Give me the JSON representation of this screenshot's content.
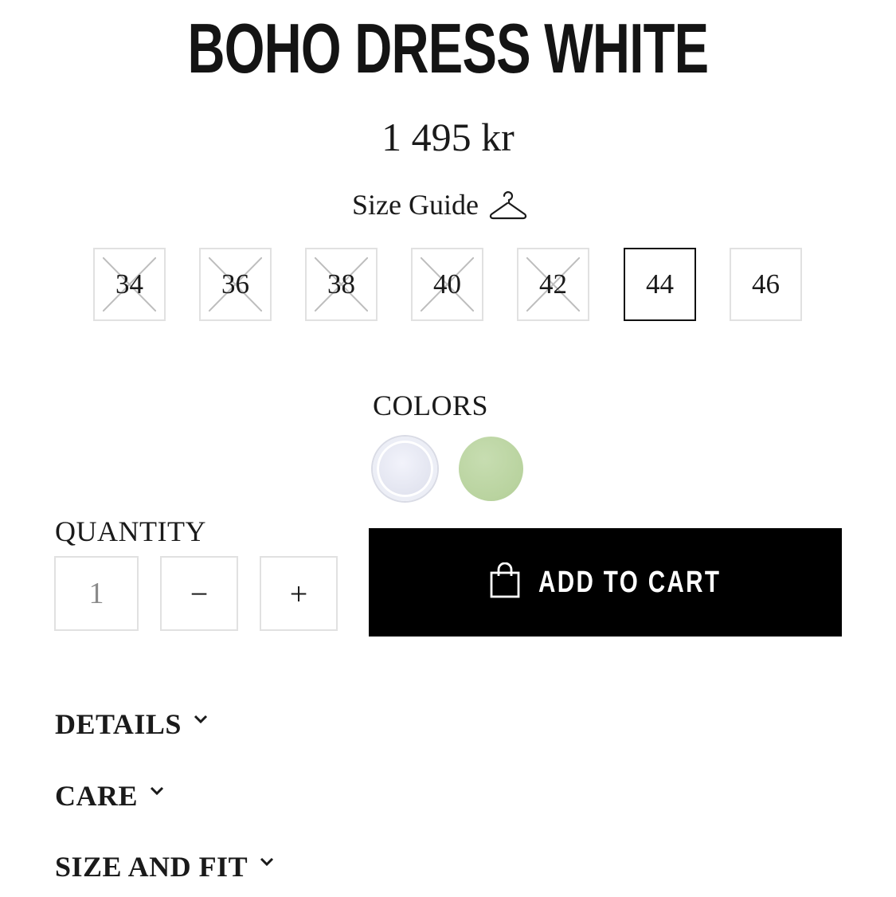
{
  "product": {
    "title": "BOHO DRESS WHITE",
    "price": "1 495 kr"
  },
  "size_guide": {
    "label": "Size Guide",
    "icon": "hanger-icon"
  },
  "sizes": [
    {
      "label": "34",
      "available": false,
      "selected": false
    },
    {
      "label": "36",
      "available": false,
      "selected": false
    },
    {
      "label": "38",
      "available": false,
      "selected": false
    },
    {
      "label": "40",
      "available": false,
      "selected": false
    },
    {
      "label": "42",
      "available": false,
      "selected": false
    },
    {
      "label": "44",
      "available": true,
      "selected": true
    },
    {
      "label": "46",
      "available": true,
      "selected": false
    }
  ],
  "colors": {
    "label": "COLORS",
    "swatches": [
      {
        "name": "white",
        "hex": "#e4e6f1",
        "selected": true
      },
      {
        "name": "green",
        "hex": "#b9d39f",
        "selected": false
      }
    ]
  },
  "quantity": {
    "label": "QUANTITY",
    "value": "1",
    "minus": "−",
    "plus": "+"
  },
  "cart": {
    "label": "ADD TO CART",
    "icon": "shopping-bag-icon"
  },
  "accordions": [
    {
      "label": "DETAILS"
    },
    {
      "label": "CARE"
    },
    {
      "label": "SIZE AND FIT"
    }
  ],
  "colors_theme": {
    "button_bg": "#000000",
    "border": "#e1e1e1",
    "text": "#1a1a1a"
  }
}
